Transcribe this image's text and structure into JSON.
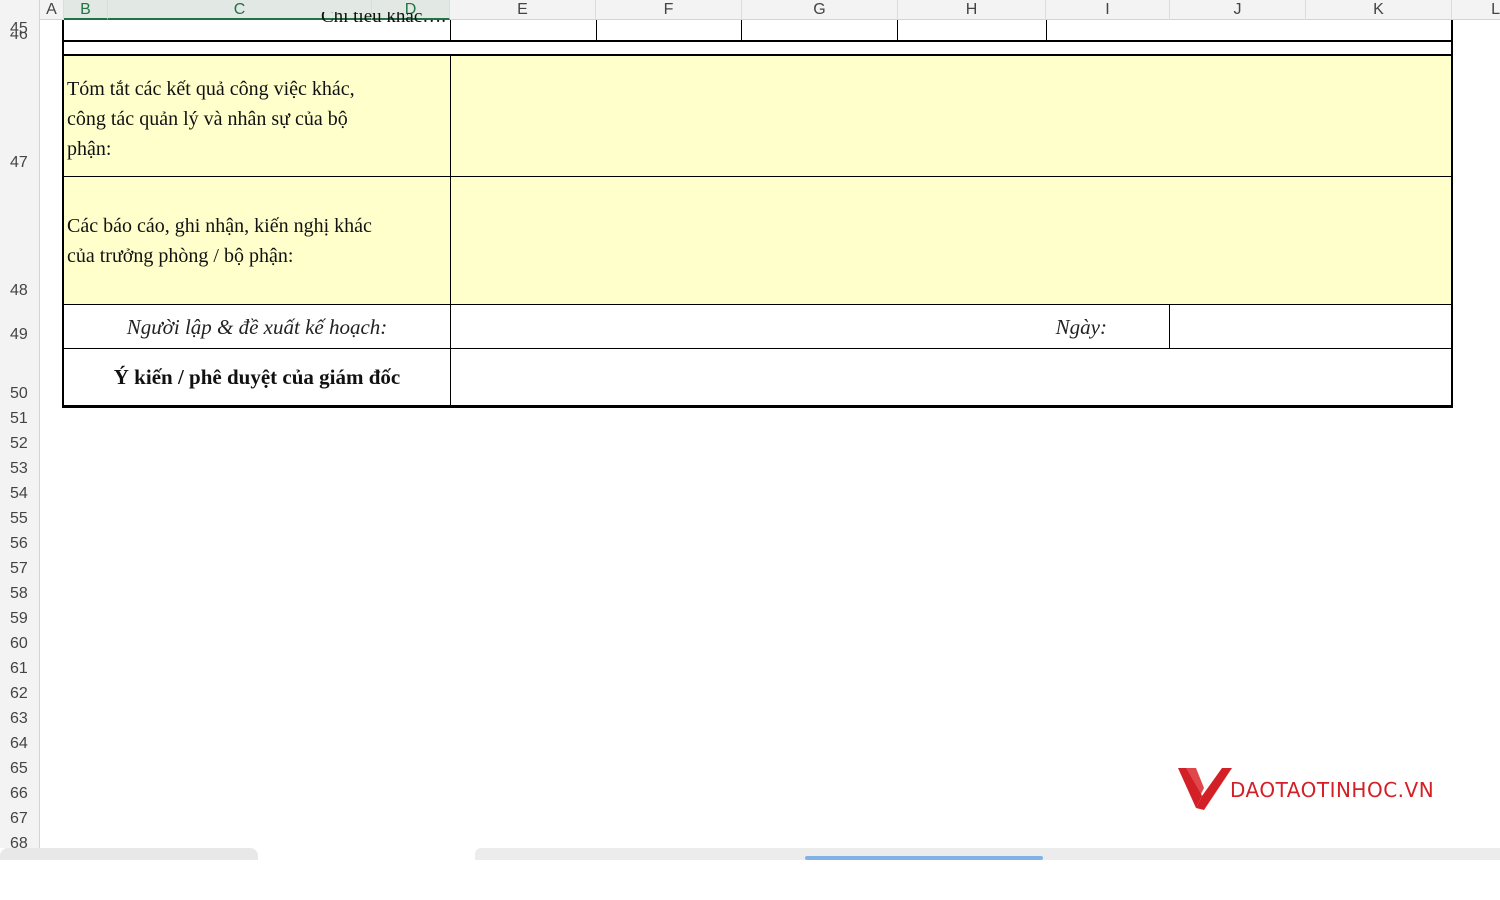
{
  "columns": [
    {
      "label": "A"
    },
    {
      "label": "B"
    },
    {
      "label": "C"
    },
    {
      "label": "D"
    },
    {
      "label": "E"
    },
    {
      "label": "F"
    },
    {
      "label": "G"
    },
    {
      "label": "H"
    },
    {
      "label": "I"
    },
    {
      "label": "J"
    },
    {
      "label": "K"
    },
    {
      "label": "L"
    }
  ],
  "rows": [
    "45",
    "46",
    "47",
    "48",
    "49",
    "50",
    "51",
    "52",
    "53",
    "54",
    "55",
    "56",
    "57",
    "58",
    "59",
    "60",
    "61",
    "62",
    "63",
    "64",
    "65",
    "66",
    "67",
    "68"
  ],
  "form": {
    "row45_label": "Chỉ tiêu khác….",
    "row47_label_line1": "Tóm tắt các kết quả công việc khác,",
    "row47_label_line2": "công tác quản lý và nhân sự của  bộ",
    "row47_label_line3": "phận:",
    "row48_label_line1": "Các báo cáo, ghi nhận, kiến nghị khác",
    "row48_label_line2": "của trưởng phòng / bộ phận:",
    "row49_label": "Người lập & đề xuất kế hoạch:",
    "row49_date_label": "Ngày:",
    "row50_label": "Ý kiến / phê duyệt của giám đốc"
  },
  "watermark": {
    "text": "DAOTAOTINHOC.VN",
    "color": "#d32027"
  },
  "colors": {
    "highlight": "#ffffcc",
    "header_bg": "#f3f3f3",
    "selected_col": "#217346"
  }
}
